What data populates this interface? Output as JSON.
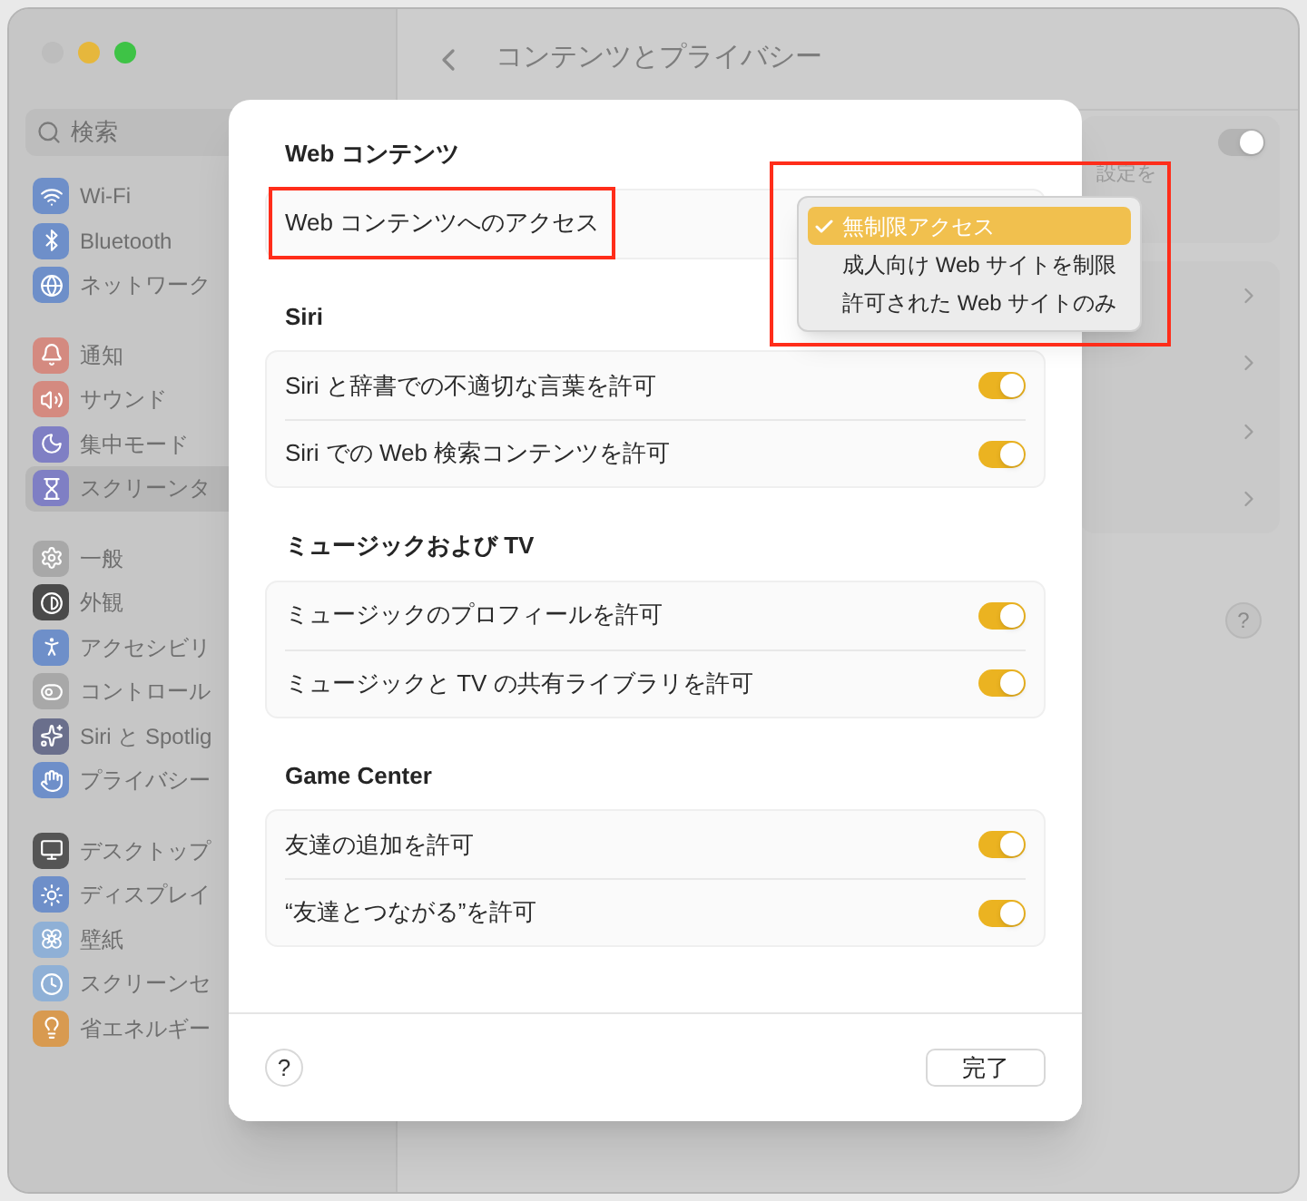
{
  "window": {
    "title": "コンテンツとプライバシー"
  },
  "search": {
    "placeholder": "検索"
  },
  "sidebar": {
    "groups": [
      {
        "items": [
          {
            "label": "Wi-Fi",
            "color": "#6e8fc9",
            "selected": false
          },
          {
            "label": "Bluetooth",
            "color": "#6e8fc9",
            "selected": false
          },
          {
            "label": "ネットワーク",
            "color": "#6e8fc9",
            "selected": false
          }
        ]
      },
      {
        "items": [
          {
            "label": "通知",
            "color": "#d48a80",
            "selected": false
          },
          {
            "label": "サウンド",
            "color": "#d48a80",
            "selected": false
          },
          {
            "label": "集中モード",
            "color": "#7f7fc4",
            "selected": false
          },
          {
            "label": "スクリーンタ",
            "color": "#7f7fc4",
            "selected": true
          }
        ]
      },
      {
        "items": [
          {
            "label": "一般",
            "color": "#a8a8a8",
            "selected": false
          },
          {
            "label": "外観",
            "color": "#4a4a4a",
            "selected": false
          },
          {
            "label": "アクセシビリ",
            "color": "#6e8fc9",
            "selected": false
          },
          {
            "label": "コントロール",
            "color": "#a8a8a8",
            "selected": false
          },
          {
            "label": "Siri と Spotlig",
            "color": "#6a6f8c",
            "selected": false
          },
          {
            "label": "プライバシー",
            "color": "#6e8fc9",
            "selected": false
          }
        ]
      },
      {
        "items": [
          {
            "label": "デスクトップ",
            "color": "#555555",
            "selected": false
          },
          {
            "label": "ディスプレイ",
            "color": "#6e8fc9",
            "selected": false
          },
          {
            "label": "壁紙",
            "color": "#8fb0d6",
            "selected": false
          },
          {
            "label": "スクリーンセ",
            "color": "#8fb0d6",
            "selected": false
          },
          {
            "label": "省エネルギー",
            "color": "#d89a50",
            "selected": false
          }
        ]
      }
    ]
  },
  "background_panel": {
    "toggle": {
      "on": true
    },
    "partial_text": "設定を",
    "help": "?"
  },
  "sheet": {
    "sections": [
      {
        "title": "Web コンテンツ",
        "rows": [
          {
            "kind": "popup",
            "label": "Web コンテンツへのアクセス"
          }
        ]
      },
      {
        "title": "Siri",
        "rows": [
          {
            "kind": "toggle",
            "label": "Siri と辞書での不適切な言葉を許可",
            "on": true
          },
          {
            "kind": "toggle",
            "label": "Siri での Web 検索コンテンツを許可",
            "on": true
          }
        ]
      },
      {
        "title": "ミュージックおよび TV",
        "rows": [
          {
            "kind": "toggle",
            "label": "ミュージックのプロフィールを許可",
            "on": true
          },
          {
            "kind": "toggle",
            "label": "ミュージックと TV の共有ライブラリを許可",
            "on": true
          }
        ]
      },
      {
        "title": "Game Center",
        "rows": [
          {
            "kind": "toggle",
            "label": "友達の追加を許可",
            "on": true
          },
          {
            "kind": "toggle",
            "label": "“友達とつながる”を許可",
            "on": true
          }
        ]
      }
    ],
    "help": "?",
    "done": "完了"
  },
  "popup_menu": {
    "items": [
      {
        "label": "無制限アクセス",
        "selected": true
      },
      {
        "label": "成人向け Web サイトを制限",
        "selected": false
      },
      {
        "label": "許可された Web サイトのみ",
        "selected": false
      }
    ]
  }
}
